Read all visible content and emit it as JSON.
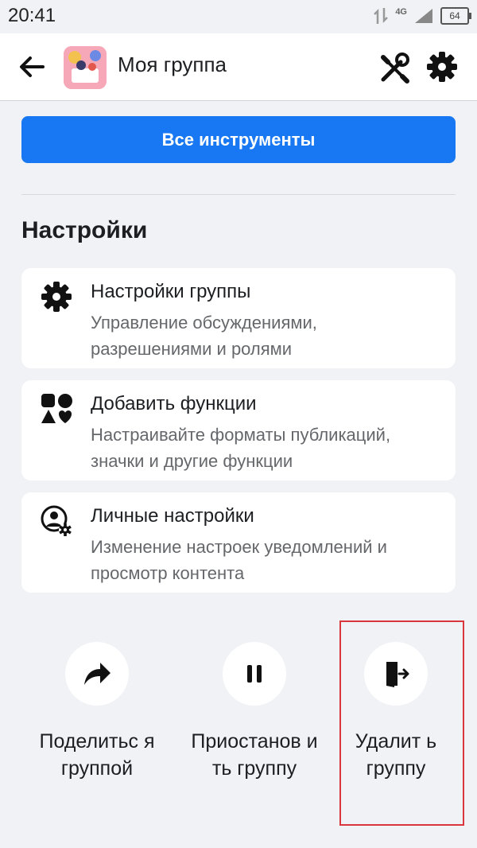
{
  "status_bar": {
    "time": "20:41",
    "network": "4G",
    "battery": "64"
  },
  "header": {
    "title": "Моя группа"
  },
  "main": {
    "all_tools_label": "Все инструменты",
    "section_title": "Настройки",
    "cards": [
      {
        "title": "Настройки группы",
        "desc": "Управление обсуждениями, разрешениями и ролями",
        "icon": "gear-icon"
      },
      {
        "title": "Добавить функции",
        "desc": "Настраивайте форматы публикаций, значки и другие функции",
        "icon": "shapes-icon"
      },
      {
        "title": "Личные настройки",
        "desc": "Изменение настроек уведомлений и просмотр контента",
        "icon": "user-gear-icon"
      }
    ],
    "actions": [
      {
        "label": "Поделитьс я группой",
        "icon": "share-icon"
      },
      {
        "label": "Приостанов ить группу",
        "icon": "pause-icon"
      },
      {
        "label": "Удалит ь группу",
        "icon": "leave-icon"
      }
    ]
  },
  "colors": {
    "accent": "#1877f2",
    "background": "#f0f2f5",
    "highlight": "#d9363e"
  }
}
